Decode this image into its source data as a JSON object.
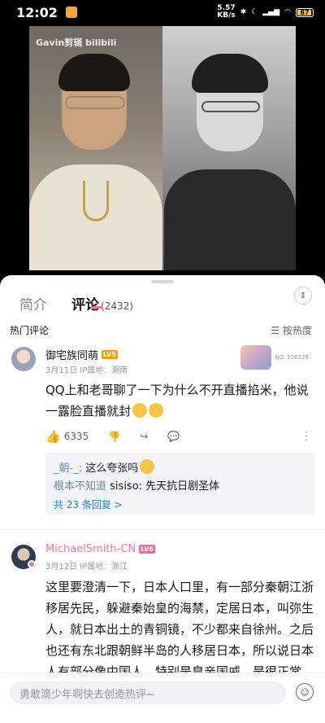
{
  "status_bar": {
    "time": "12:02",
    "net_speed_value": "5.57",
    "net_speed_unit": "KB/s",
    "battery": "87"
  },
  "video": {
    "watermark": "Gavin剪辑 bilibili"
  },
  "tabs": [
    {
      "label": "简介"
    },
    {
      "label": "评论",
      "count": "(2432)"
    }
  ],
  "sort": {
    "section_title": "热门评论",
    "sort_label": "按热度"
  },
  "comments": [
    {
      "username": "御宅族同萌",
      "level": "LV5",
      "meta": "3月11日 IP属地：湖南",
      "text": "QQ上和老哥聊了一下为什么不开直播掐米，他说一露脸直播就封",
      "fan_badge_text": "NO. 106228",
      "likes": "6335",
      "replies": [
        {
          "user": "_朝-_:",
          "text": "这么夸张吗"
        },
        {
          "user": "根本不知道",
          "text": "sisiso: 先天抗日剧圣体"
        }
      ],
      "more_replies": "共 23 条回复 >"
    },
    {
      "username": "MichaelSmith-CN",
      "level": "LV6",
      "meta": "3月12日 IP属地：浙江",
      "text": "这里要澄清一下，日本人口里，有一部分秦朝江浙移居先民，躲避秦始皇的海禁，定居日本，叫弥生人，就日本出土的青铜镜，不少都来自徐州。之后也还有东北跟朝鲜半岛的人移居日本，所以说日本人有部分像中国人，特别是皇亲国戚。是很正常"
    }
  ],
  "input": {
    "placeholder": "勇敢滴少年啊快去创造热评~"
  }
}
